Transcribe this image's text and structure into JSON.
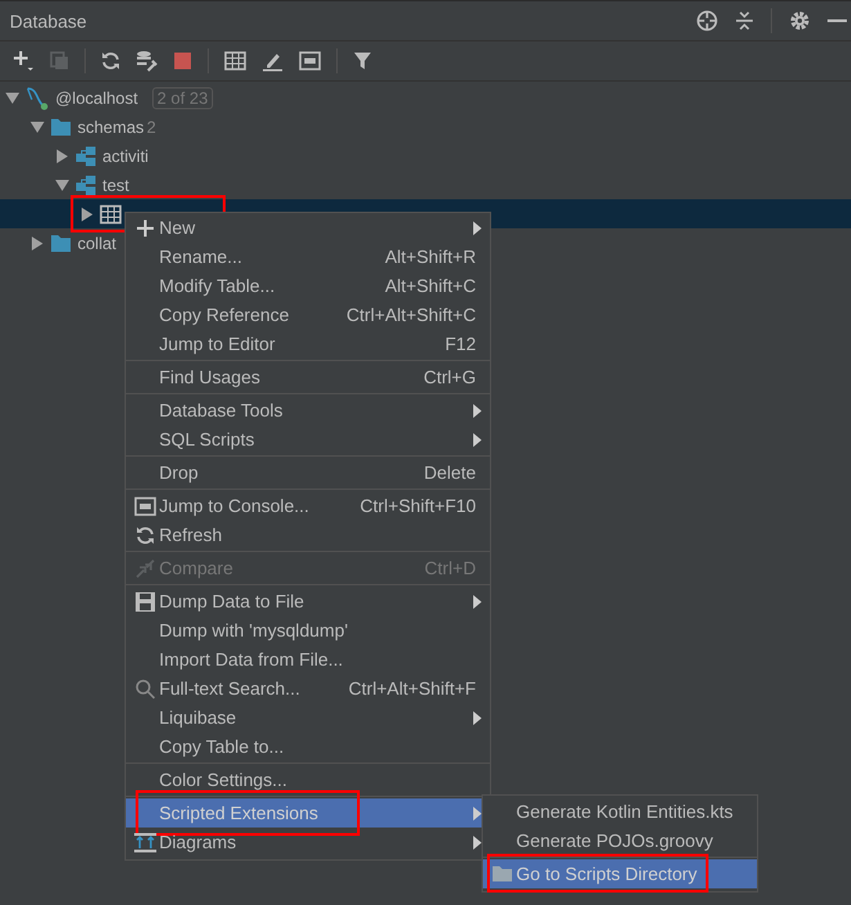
{
  "panel": {
    "title": "Database"
  },
  "tree": [
    {
      "label": "@localhost",
      "kind": "connection",
      "badge": "2 of 23",
      "expanded": true,
      "selected": false,
      "children": [
        {
          "label": "schemas",
          "kind": "folder",
          "count": "2",
          "expanded": true,
          "selected": false,
          "children": [
            {
              "label": "activiti",
              "kind": "schema",
              "expanded": false,
              "selected": false
            },
            {
              "label": "test",
              "kind": "schema",
              "expanded": true,
              "selected": false,
              "children": [
                {
                  "kind": "table",
                  "expanded": false,
                  "selected": true,
                  "annotated": true
                }
              ]
            }
          ]
        },
        {
          "label": "collat",
          "kind": "folder",
          "expanded": false,
          "selected": false
        }
      ]
    }
  ],
  "menu": [
    {
      "kind": "item",
      "label": "New",
      "submenu": true
    },
    {
      "kind": "item",
      "label": "Rename...",
      "shortcut": "Alt+Shift+R"
    },
    {
      "kind": "item",
      "label": "Modify Table...",
      "shortcut": "Alt+Shift+C"
    },
    {
      "kind": "item",
      "label": "Copy Reference",
      "shortcut": "Ctrl+Alt+Shift+C"
    },
    {
      "kind": "item",
      "label": "Jump to Editor",
      "shortcut": "F12"
    },
    {
      "kind": "separator"
    },
    {
      "kind": "item",
      "label": "Find Usages",
      "shortcut": "Ctrl+G"
    },
    {
      "kind": "separator"
    },
    {
      "kind": "item",
      "label": "Database Tools",
      "submenu": true
    },
    {
      "kind": "item",
      "label": "SQL Scripts",
      "submenu": true
    },
    {
      "kind": "separator"
    },
    {
      "kind": "item",
      "label": "Drop",
      "shortcut": "Delete"
    },
    {
      "kind": "separator"
    },
    {
      "kind": "item",
      "label": "Jump to Console...",
      "shortcut": "Ctrl+Shift+F10"
    },
    {
      "kind": "item",
      "label": "Refresh"
    },
    {
      "kind": "separator"
    },
    {
      "kind": "item",
      "label": "Compare",
      "shortcut": "Ctrl+D",
      "disabled": true
    },
    {
      "kind": "separator"
    },
    {
      "kind": "item",
      "label": "Dump Data to File",
      "submenu": true
    },
    {
      "kind": "item",
      "label": "Dump with 'mysqldump'"
    },
    {
      "kind": "item",
      "label": "Import Data from File..."
    },
    {
      "kind": "item",
      "label": "Full-text Search...",
      "shortcut": "Ctrl+Alt+Shift+F"
    },
    {
      "kind": "item",
      "label": "Liquibase",
      "submenu": true
    },
    {
      "kind": "item",
      "label": "Copy Table to..."
    },
    {
      "kind": "separator"
    },
    {
      "kind": "item",
      "label": "Color Settings..."
    },
    {
      "kind": "separator"
    },
    {
      "kind": "item",
      "label": "Scripted Extensions",
      "submenu": true,
      "selected": true,
      "annotated": true,
      "children": [
        {
          "kind": "item",
          "label": "Generate Kotlin Entities.kts"
        },
        {
          "kind": "item",
          "label": "Generate POJOs.groovy"
        },
        {
          "kind": "separator"
        },
        {
          "kind": "item",
          "label": "Go to Scripts Directory",
          "selected": true,
          "annotated": true
        }
      ]
    },
    {
      "kind": "item",
      "label": "Diagrams",
      "submenu": true
    }
  ]
}
